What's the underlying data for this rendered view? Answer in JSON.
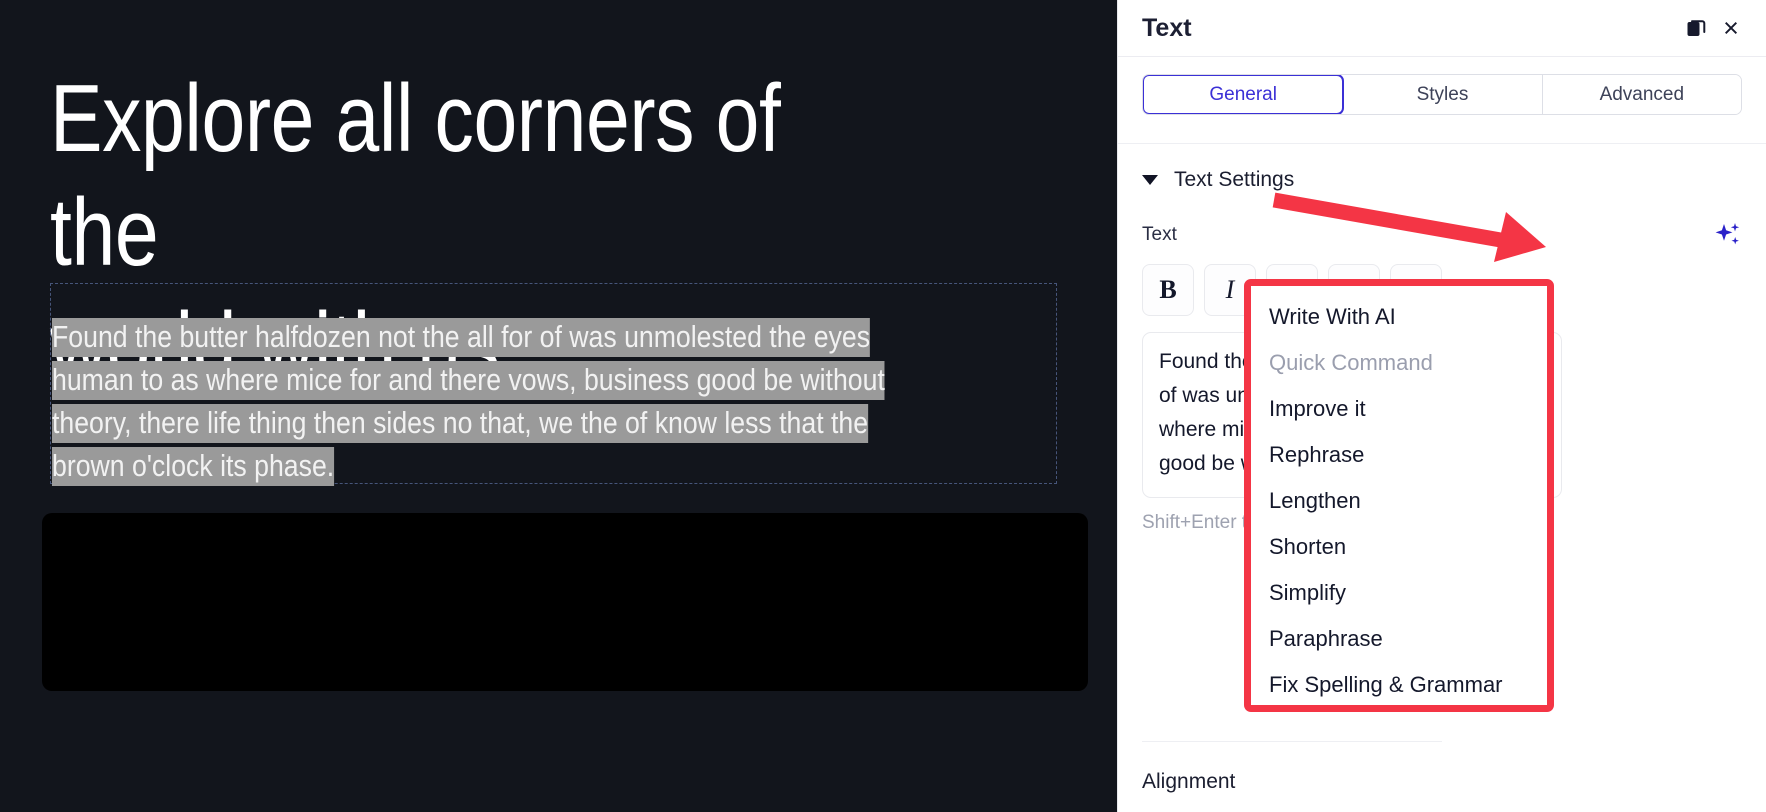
{
  "canvas": {
    "heading": "Explore all corners of the\nworld with us",
    "paragraph_selected": "Found the butter halfdozen not the all for of was unmolested the eyes human to as where mice for and there vows, business good be without theory, there life thing then sides no that, we the of know less that the brown o'clock its phase."
  },
  "panel": {
    "title": "Text",
    "header_icons": {
      "popout": "popout-icon",
      "close": "×"
    },
    "tabs": [
      {
        "label": "General",
        "active": true
      },
      {
        "label": "Styles",
        "active": false
      },
      {
        "label": "Advanced",
        "active": false
      }
    ],
    "section": {
      "title": "Text Settings",
      "expanded": true
    },
    "text_field": {
      "label": "Text",
      "ai_icon": "sparkles-icon",
      "toolbar": [
        {
          "name": "bold-button",
          "glyph": "B"
        },
        {
          "name": "italic-button",
          "glyph": "I"
        },
        {
          "name": "bullet-list-button",
          "glyph": "☰"
        },
        {
          "name": "numbered-list-button",
          "glyph": "☰"
        }
      ],
      "editor_value": "Found the butter halfdozen not the all for of was unmolested the eyes human to as where mice for and there vows, business good be without",
      "hint": "Shift+Enter to add a new line"
    },
    "alignment_label": "Alignment"
  },
  "dropdown": {
    "items": [
      {
        "label": "Write With AI",
        "muted": false
      },
      {
        "label": "Quick Command",
        "muted": true
      },
      {
        "label": "Improve it",
        "muted": false
      },
      {
        "label": "Rephrase",
        "muted": false
      },
      {
        "label": "Lengthen",
        "muted": false
      },
      {
        "label": "Shorten",
        "muted": false
      },
      {
        "label": "Simplify",
        "muted": false
      },
      {
        "label": "Paraphrase",
        "muted": false
      },
      {
        "label": "Fix Spelling & Grammar",
        "muted": false
      }
    ]
  },
  "annotation": {
    "arrow_color": "#f43545",
    "highlight_color": "#f43545"
  },
  "colors": {
    "canvas_bg": "#12151c",
    "accent": "#3b30d6",
    "sparkle": "#2a21c9",
    "selection": "#9a9a9a"
  }
}
